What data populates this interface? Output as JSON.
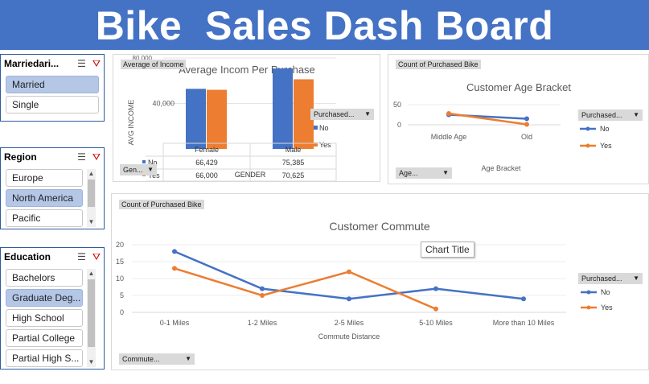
{
  "banner": {
    "title": "Bike  Sales Dash Board"
  },
  "slicers": {
    "marital": {
      "title": "Marriedari...",
      "items": [
        "Married",
        "Single"
      ]
    },
    "region": {
      "title": "Region",
      "items": [
        "Europe",
        "North America",
        "Pacific"
      ]
    },
    "education": {
      "title": "Education",
      "items": [
        "Bachelors",
        "Graduate Deg...",
        "High School",
        "Partial College",
        "Partial High S..."
      ]
    }
  },
  "icons": {
    "multiselect": "multiselect-icon",
    "clear_filter": "clear-filter-icon",
    "scroll_up": "▲",
    "scroll_down": "▼"
  },
  "colors": {
    "no": "#4472c4",
    "yes": "#ed7d31",
    "banner": "#4472c4",
    "selected": "#b4c7e7"
  },
  "income_chart": {
    "field_tag": "Average of Income",
    "axis_field": "Gen...",
    "legend_field": "Purchased...",
    "y_top_tick": "80,000",
    "y_mid_tick": "40,000",
    "y_axis_label": "AVG INCOME",
    "x_axis_label": "GENDER",
    "table_headers": [
      "Female",
      "Male"
    ],
    "table_rows": [
      {
        "key": "No",
        "values": [
          "66,429",
          "75,385"
        ]
      },
      {
        "key": "Yes",
        "values": [
          "66,000",
          "70,625"
        ]
      }
    ]
  },
  "age_chart": {
    "field_tag": "Count of Purchased Bike",
    "axis_field": "Age...",
    "legend_field": "Purchased..."
  },
  "commute_chart": {
    "field_tag": "Count of Purchased Bike",
    "axis_field": "Commute...",
    "legend_field": "Purchased...",
    "title_tooltip": "Chart Title"
  },
  "chart_data": [
    {
      "type": "bar",
      "title": "Average Incom Per Purchase",
      "xlabel": "GENDER",
      "ylabel": "AVG INCOME",
      "categories": [
        "Female",
        "Male"
      ],
      "series": [
        {
          "name": "No",
          "values": [
            66429,
            75385
          ]
        },
        {
          "name": "Yes",
          "values": [
            66000,
            70625
          ]
        }
      ],
      "ylim": [
        40000,
        80000
      ],
      "legend": "right"
    },
    {
      "type": "line",
      "title": "Customer Age Bracket",
      "xlabel": "Age Bracket",
      "categories": [
        "Middle Age",
        "Old"
      ],
      "series": [
        {
          "name": "No",
          "values": [
            25,
            15
          ]
        },
        {
          "name": "Yes",
          "values": [
            28,
            1
          ]
        }
      ],
      "yticks": [
        0,
        50
      ],
      "ylim": [
        0,
        50
      ],
      "legend": "right"
    },
    {
      "type": "line",
      "title": "Customer Commute",
      "xlabel": "Commute Distance",
      "categories": [
        "0-1 Miles",
        "1-2 Miles",
        "2-5 Miles",
        "5-10 Miles",
        "More than 10 Miles"
      ],
      "series": [
        {
          "name": "No",
          "values": [
            18,
            7,
            4,
            7,
            4
          ]
        },
        {
          "name": "Yes",
          "values": [
            13,
            5,
            12,
            1,
            null
          ]
        }
      ],
      "yticks": [
        0,
        5,
        10,
        15,
        20
      ],
      "ylim": [
        0,
        20
      ],
      "legend": "right"
    }
  ]
}
